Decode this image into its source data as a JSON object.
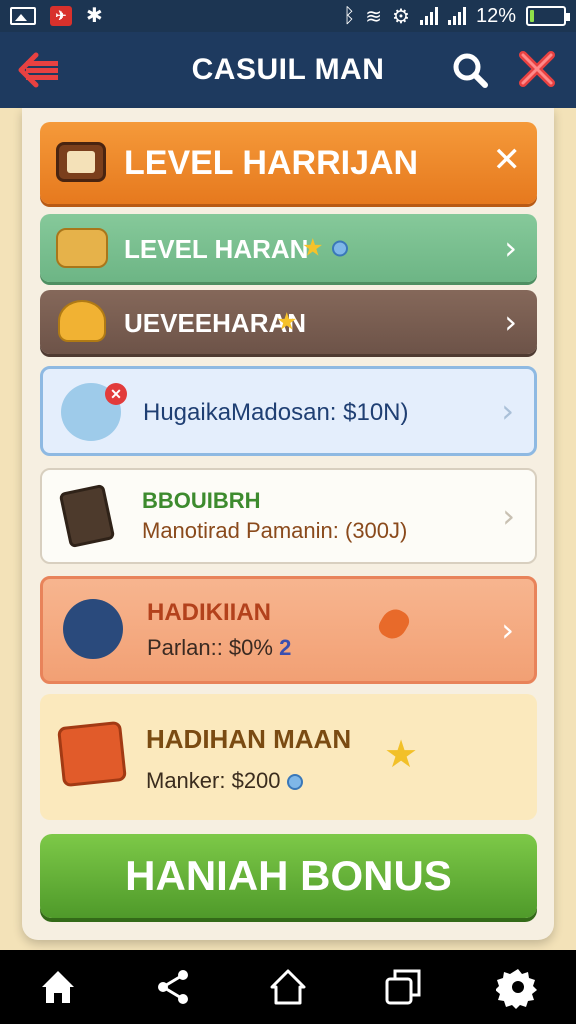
{
  "status_bar": {
    "battery_percent": "12%",
    "battery_level": 0.12
  },
  "app_bar": {
    "title": "CASUIL MAN"
  },
  "rows": [
    {
      "label": "LEVEL HARRIJAN"
    },
    {
      "label": "LEVEL HARAN"
    },
    {
      "label": "UEVEEHARAN"
    },
    {
      "label": "HugaikaMadosan: $10N)"
    },
    {
      "label": "BBOUIBRH",
      "sublabel": "Manotirad Pamanin:  (300J)"
    },
    {
      "label": "HADIKIIAN",
      "sublabel": "Parlan:: $0%",
      "badge": "2"
    },
    {
      "label": "HADIHAN MAAN",
      "sublabel": "Manker: $200"
    }
  ],
  "bonus_button": {
    "label": "HANIAH BONUS"
  },
  "colors": {
    "appbar": "#1e3a5f",
    "orange": "#f59a3a",
    "green": "#6db585",
    "brown": "#6d5348",
    "bonus_green": "#5fae33"
  }
}
